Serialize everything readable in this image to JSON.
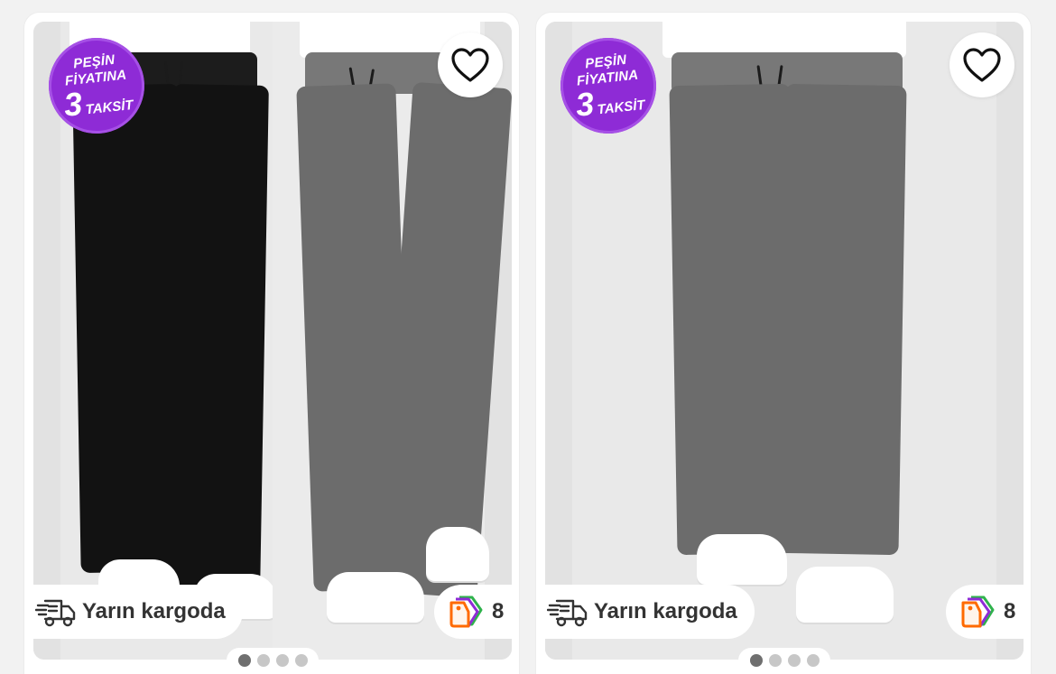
{
  "products": [
    {
      "promo": {
        "line1": "PEŞİN",
        "line2": "FİYATINA",
        "number": "3",
        "word": "TAKSİT"
      },
      "favorite_icon": "heart-outline-icon",
      "shipping": {
        "icon": "truck-icon",
        "label": "Yarın kargoda"
      },
      "offers": {
        "icon": "multi-tag-icon",
        "count": "8"
      },
      "carousel": {
        "total": 4,
        "active": 1
      }
    },
    {
      "promo": {
        "line1": "PEŞİN",
        "line2": "FİYATINA",
        "number": "3",
        "word": "TAKSİT"
      },
      "favorite_icon": "heart-outline-icon",
      "shipping": {
        "icon": "truck-icon",
        "label": "Yarın kargoda"
      },
      "offers": {
        "icon": "multi-tag-icon",
        "count": "8"
      },
      "carousel": {
        "total": 4,
        "active": 1
      }
    }
  ],
  "colors": {
    "promo_purple": "#8e2bd6",
    "tag_orange": "#ff6a00",
    "tag_purple": "#8e2bd6",
    "tag_green": "#2fb24c",
    "text_dark": "#333333",
    "page_background": "#f2f2f2"
  }
}
